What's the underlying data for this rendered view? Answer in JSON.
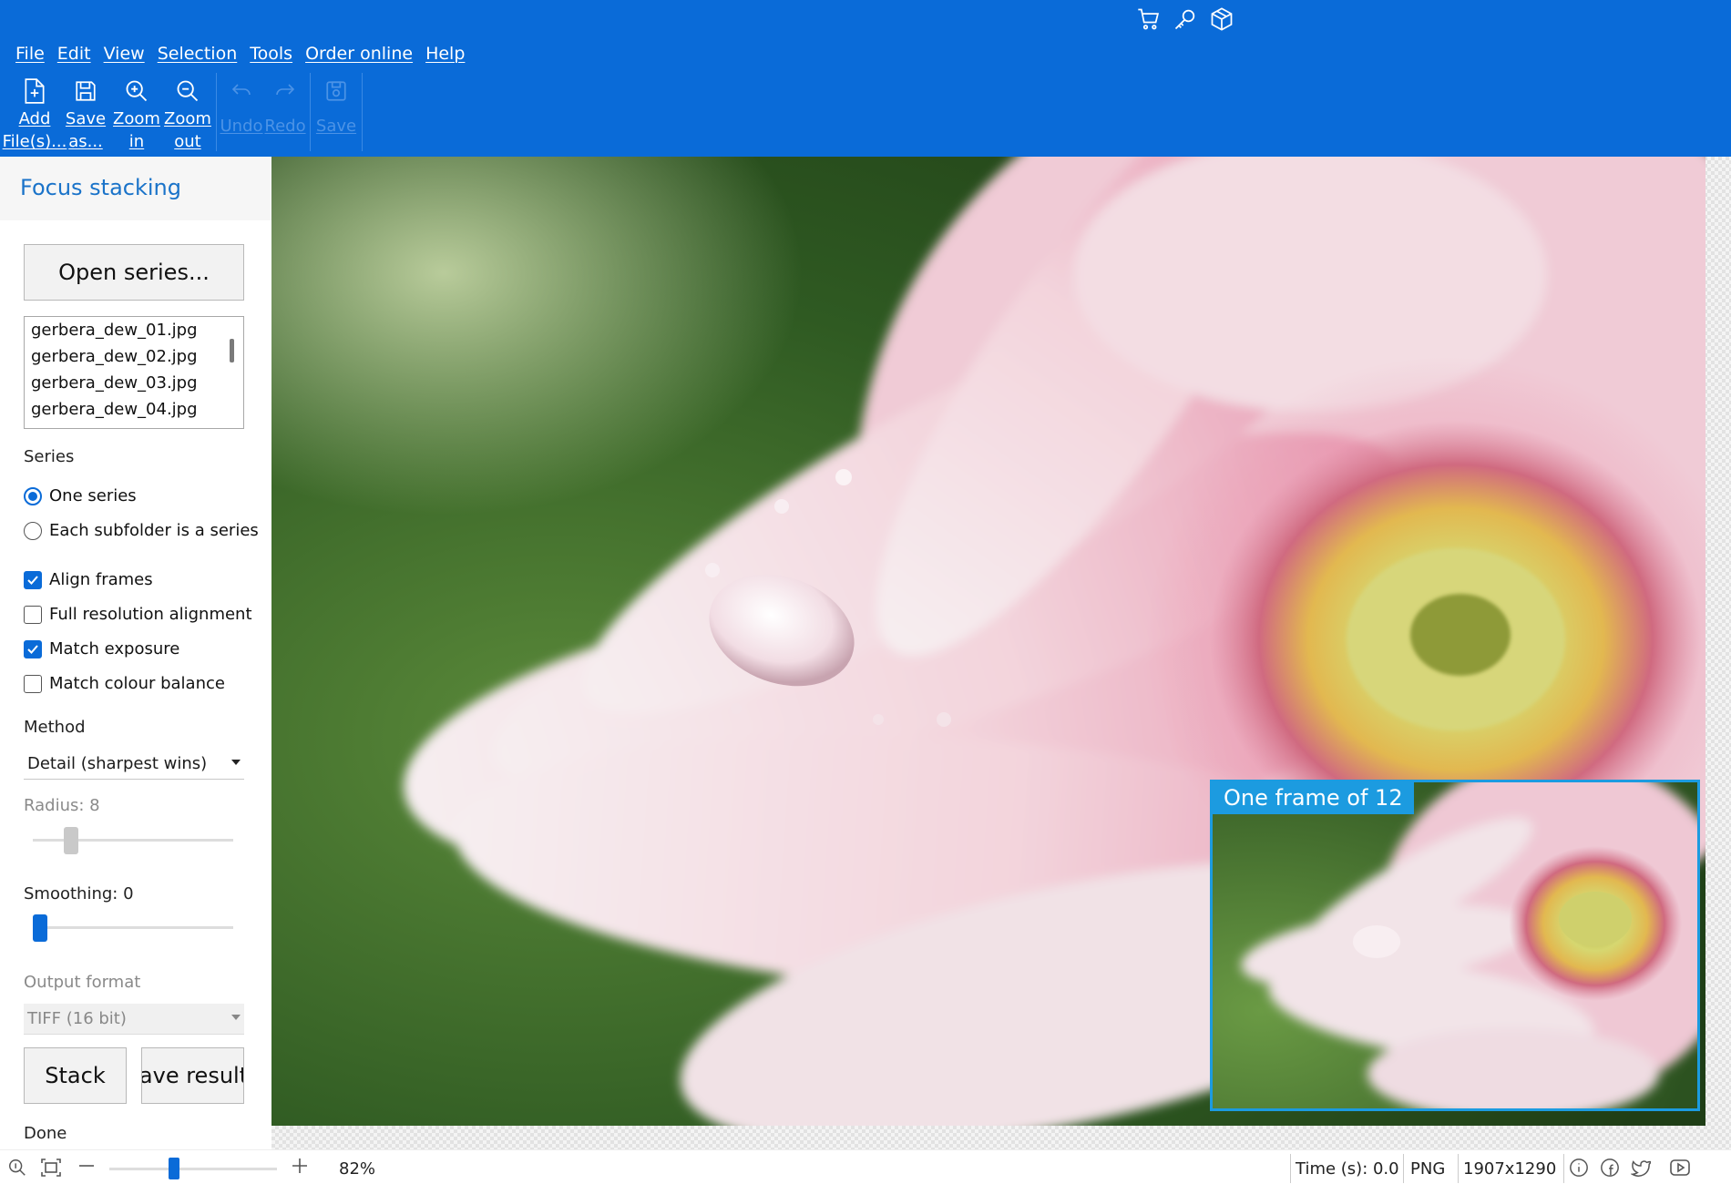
{
  "header": {
    "top_icons": [
      "cart-icon",
      "key-icon",
      "box-icon"
    ],
    "menu": [
      "File",
      "Edit",
      "View",
      "Selection",
      "Tools",
      "Order online",
      "Help"
    ],
    "toolbar": {
      "add_files": [
        "Add",
        "File(s)..."
      ],
      "save_as": [
        "Save",
        "as..."
      ],
      "zoom_in": [
        "Zoom",
        "in"
      ],
      "zoom_out": [
        "Zoom",
        "out"
      ],
      "undo": "Undo",
      "redo": "Redo",
      "save": "Save"
    }
  },
  "sidebar": {
    "title": "Focus stacking",
    "open_series": "Open series...",
    "files": [
      "gerbera_dew_01.jpg",
      "gerbera_dew_02.jpg",
      "gerbera_dew_03.jpg",
      "gerbera_dew_04.jpg"
    ],
    "series_label": "Series",
    "series_options": [
      {
        "label": "One series",
        "selected": true
      },
      {
        "label": "Each subfolder is a series",
        "selected": false
      }
    ],
    "checkboxes": [
      {
        "label": "Align frames",
        "checked": true
      },
      {
        "label": "Full resolution alignment",
        "checked": false
      },
      {
        "label": "Match exposure",
        "checked": true
      },
      {
        "label": "Match colour balance",
        "checked": false
      }
    ],
    "method_label": "Method",
    "method_value": "Detail (sharpest wins)",
    "radius_label": "Radius: 8",
    "radius_value": 8,
    "smoothing_label": "Smoothing: 0",
    "smoothing_value": 0,
    "output_format_label": "Output format",
    "output_format_value": "TIFF (16 bit)",
    "stack_button": "Stack",
    "save_result_button": "Save result...",
    "status": "Done"
  },
  "canvas": {
    "inset_label": "One frame of 12"
  },
  "statusbar": {
    "zoom": "82%",
    "zoom_fraction": 0.38,
    "time": "Time (s): 0.0",
    "format": "PNG",
    "dimensions": "1907x1290",
    "icons": [
      "zoom-reset-icon",
      "fit-screen-icon",
      "zoom-out-icon",
      "zoom-in-icon",
      "info-icon",
      "facebook-icon",
      "twitter-icon",
      "youtube-icon"
    ]
  },
  "colors": {
    "header_bg": "#0a6bd8",
    "accent": "#0a6bd8",
    "inset_border": "#1c9be0",
    "title_color": "#1a73c9"
  }
}
